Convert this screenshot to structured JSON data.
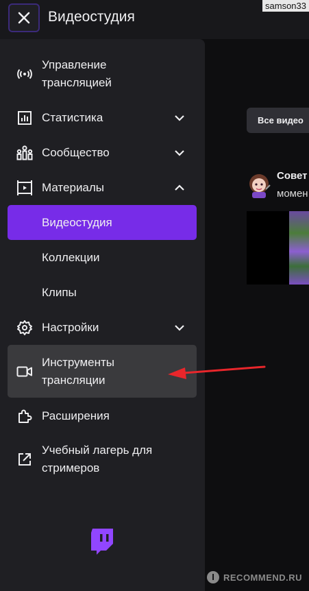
{
  "header": {
    "title": "Видеостудия",
    "watermark_user": "samson33"
  },
  "sidebar": {
    "items": [
      {
        "label": "Управление трансляцией",
        "icon": "broadcast-icon",
        "expandable": false
      },
      {
        "label": "Статистика",
        "icon": "chart-icon",
        "expandable": true,
        "expanded": false
      },
      {
        "label": "Сообщество",
        "icon": "community-icon",
        "expandable": true,
        "expanded": false
      },
      {
        "label": "Материалы",
        "icon": "media-icon",
        "expandable": true,
        "expanded": true
      },
      {
        "label": "Видеостудия",
        "icon": null,
        "active": true
      },
      {
        "label": "Коллекции",
        "icon": null
      },
      {
        "label": "Клипы",
        "icon": null
      },
      {
        "label": "Настройки",
        "icon": "gear-icon",
        "expandable": true,
        "expanded": false
      },
      {
        "label": "Инструменты трансляции",
        "icon": "camera-icon",
        "highlighted": true
      },
      {
        "label": "Расширения",
        "icon": "puzzle-icon"
      },
      {
        "label": "Учебный лагерь для стримеров",
        "icon": "external-link-icon"
      }
    ]
  },
  "main": {
    "filter_label": "Все видео",
    "video": {
      "title_line1": "Совет",
      "title_line2": "момен"
    }
  },
  "colors": {
    "accent": "#772ce8",
    "sidebar_bg": "#1f1f23",
    "page_bg": "#0e0e10",
    "annotation_arrow": "#e8262b"
  },
  "watermark": {
    "badge": "I",
    "text": "RECOMMEND.RU"
  }
}
